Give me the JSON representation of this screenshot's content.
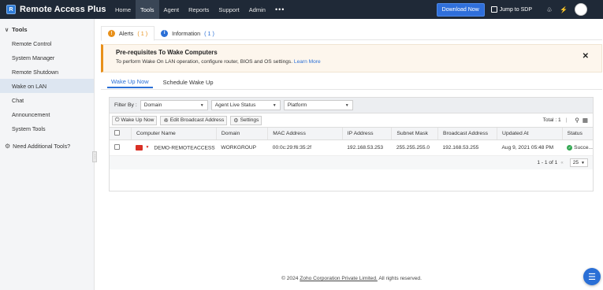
{
  "header": {
    "brand": "Remote Access Plus",
    "nav": [
      "Home",
      "Tools",
      "Agent",
      "Reports",
      "Support",
      "Admin"
    ],
    "active_nav": "Tools",
    "more": "•••",
    "download_label": "Download Now",
    "jump_label": "Jump to SDP"
  },
  "sidebar": {
    "heading": "Tools",
    "items": [
      "Remote Control",
      "System Manager",
      "Remote Shutdown",
      "Wake on LAN",
      "Chat",
      "Announcement",
      "System Tools"
    ],
    "active_item": "Wake on LAN",
    "extra": "Need Additional Tools?"
  },
  "alerts": {
    "tabs": [
      {
        "label": "Alerts",
        "count": "( 1 )"
      },
      {
        "label": "Information",
        "count": "( 1 )"
      }
    ],
    "banner_title": "Pre-requisites To Wake Computers",
    "banner_text": "To perform Wake On LAN operation, configure router, BIOS and OS settings.",
    "banner_link": "Learn More"
  },
  "subtabs": [
    "Wake Up Now",
    "Schedule Wake Up"
  ],
  "filters": {
    "label": "Filter By :",
    "selects": [
      "Domain",
      "Agent Live Status",
      "Platform"
    ]
  },
  "toolbar": {
    "buttons": [
      "Wake Up Now",
      "Edit Broadcast Address",
      "Settings"
    ],
    "total": "Total : 1"
  },
  "table": {
    "columns": [
      "Computer Name",
      "Domain",
      "MAC Address",
      "IP Address",
      "Subnet Mask",
      "Broadcast Address",
      "Updated At",
      "Status"
    ],
    "rows": [
      {
        "computer": "DEMO-REMOTEACCESS",
        "domain": "WORKGROUP",
        "mac": "00:0c:29:f6:35:2f",
        "ip": "192.168.53.253",
        "subnet": "255.255.255.0",
        "broadcast": "192.168.53.255",
        "updated": "Aug 9, 2021 05:48 PM",
        "status": "Succe..."
      }
    ]
  },
  "pager": {
    "range": "1 - 1 of 1",
    "page_size": "25"
  },
  "footer": {
    "prefix": "© 2024",
    "company": "Zoho Corporation Private Limited.",
    "suffix": "All rights reserved."
  },
  "colors": {
    "topbar": "#1f2937",
    "accent": "#2a6fd6",
    "warning": "#e8901a",
    "success": "#34a853"
  }
}
